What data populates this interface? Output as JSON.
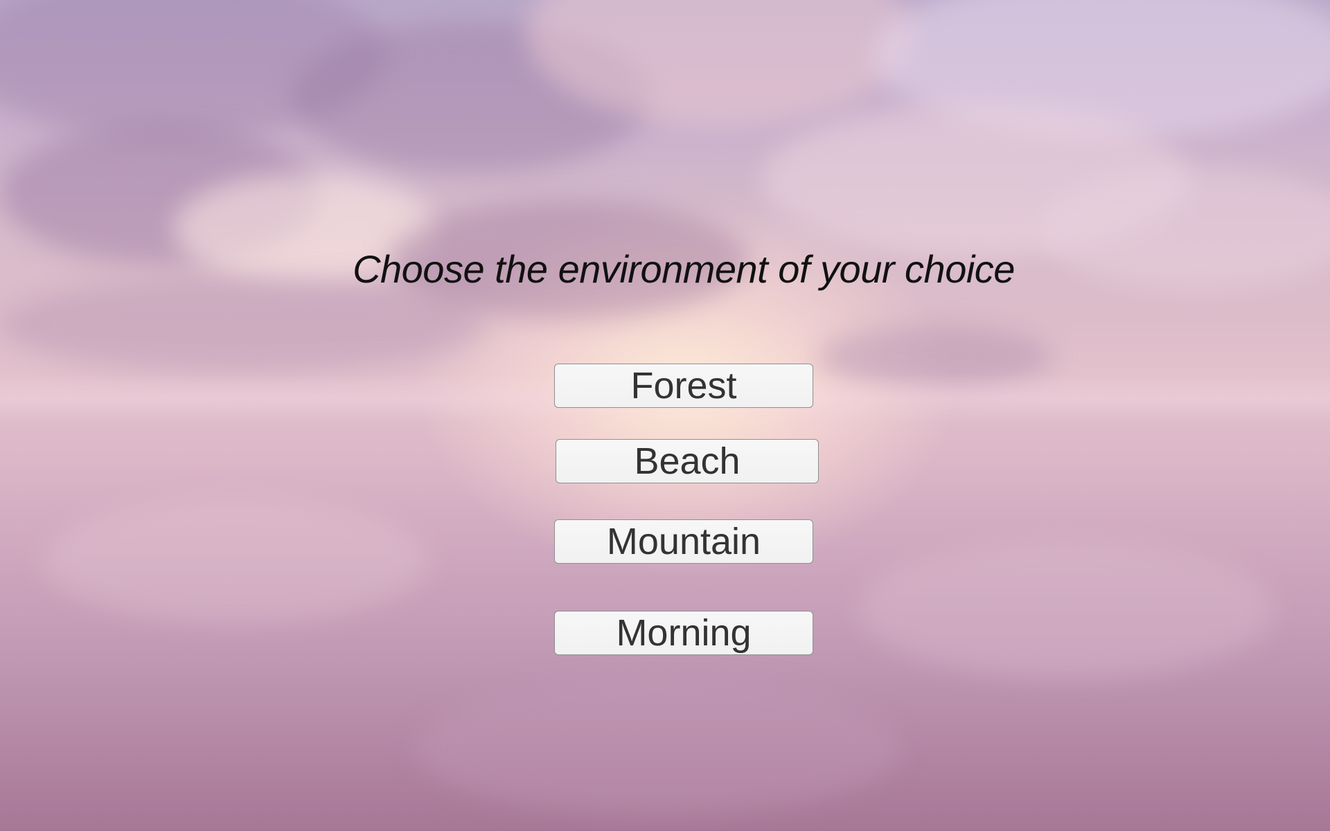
{
  "screen": {
    "title": "Choose the environment of your choice",
    "background": "sky-clouds-reflection"
  },
  "environments": [
    {
      "label": "Forest"
    },
    {
      "label": "Beach"
    },
    {
      "label": "Mountain"
    },
    {
      "label": "Morning"
    }
  ],
  "colors": {
    "title_text": "#111111",
    "button_bg": "#f4f4f4",
    "button_border": "#8f8f8f",
    "button_text": "#333333"
  }
}
